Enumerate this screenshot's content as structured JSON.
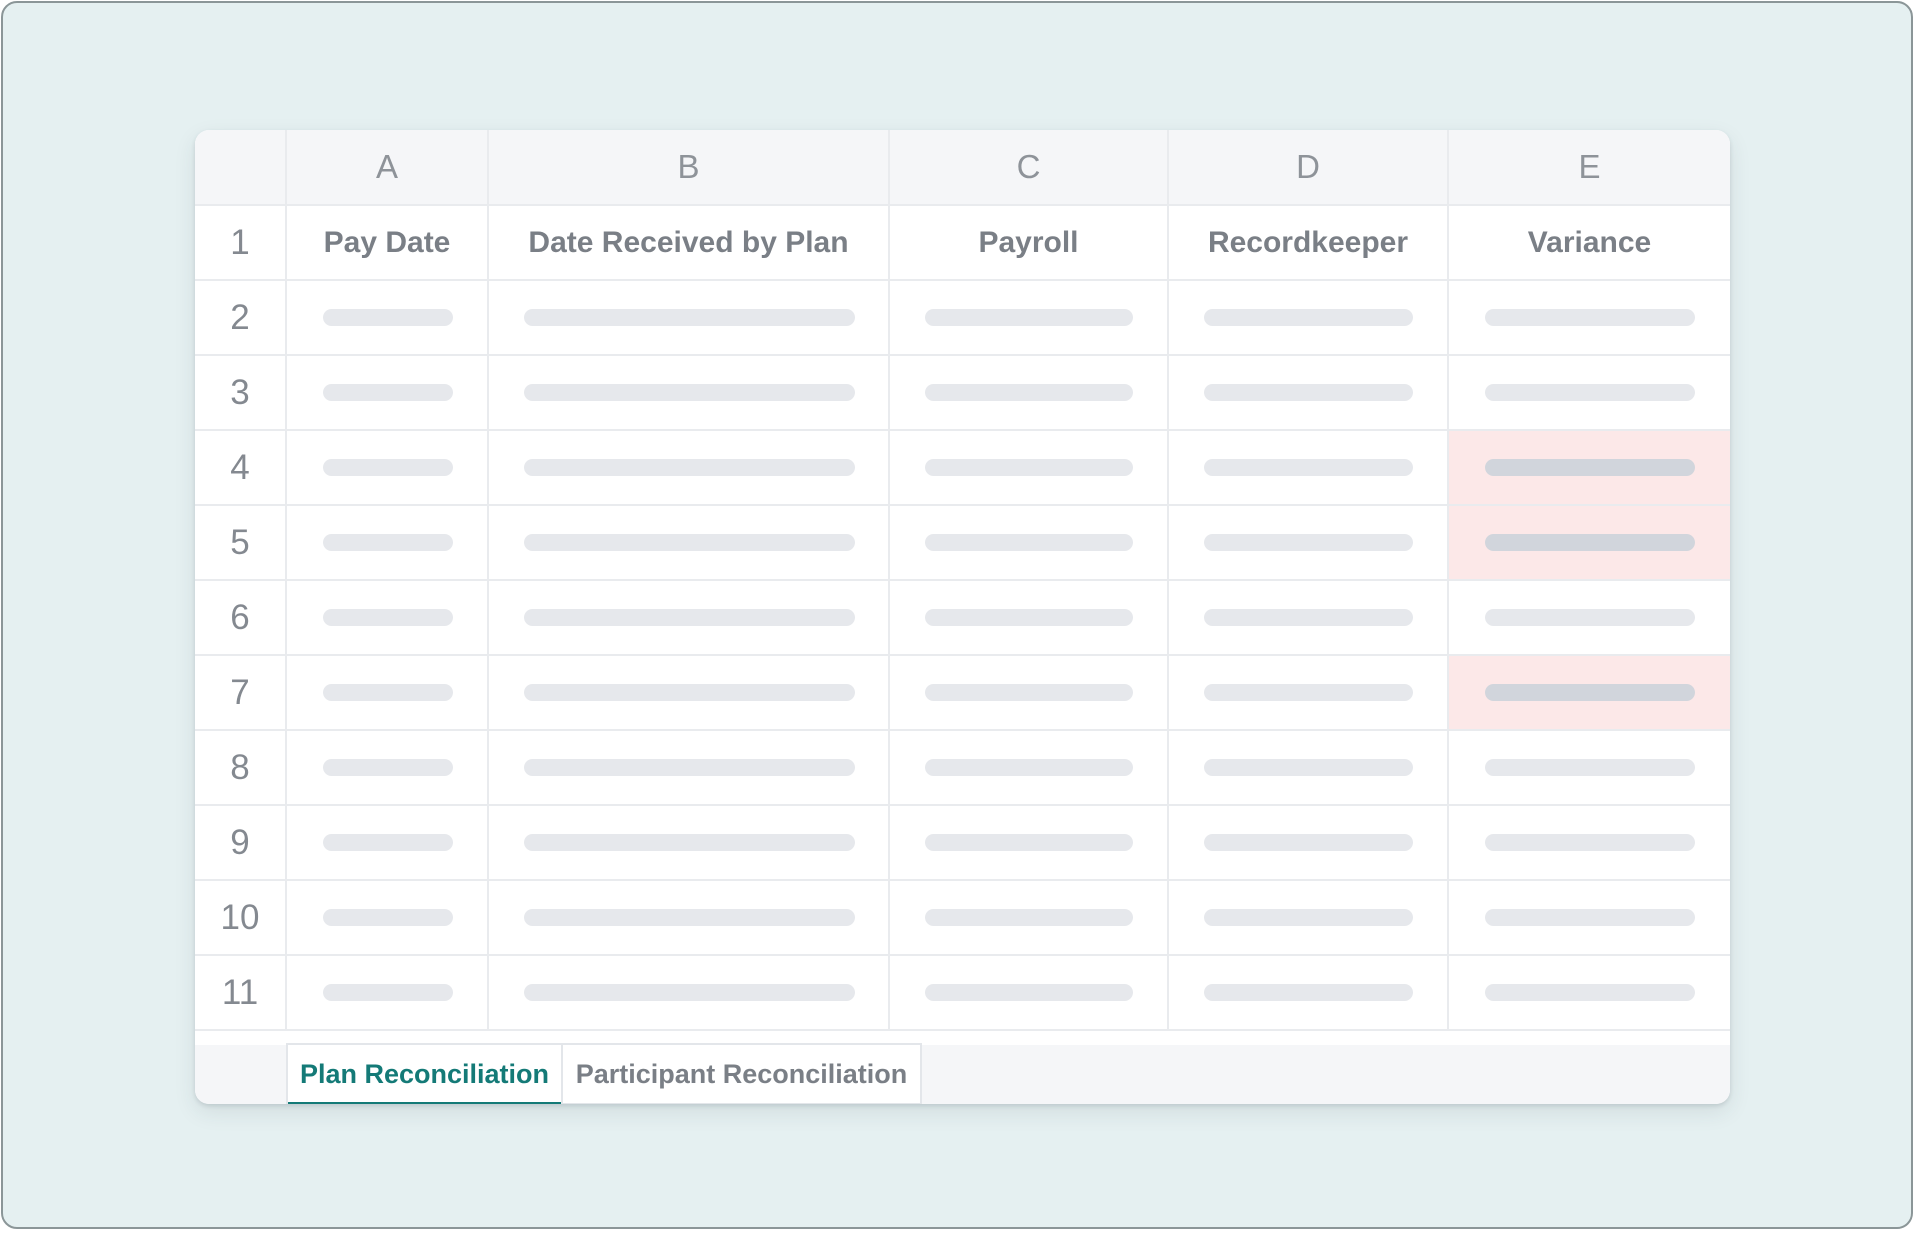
{
  "spreadsheet": {
    "columns": [
      "A",
      "B",
      "C",
      "D",
      "E"
    ],
    "header_row_number": "1",
    "headers": [
      "Pay Date",
      "Date Received by Plan",
      "Payroll",
      "Recordkeeper",
      "Variance"
    ],
    "rows": [
      {
        "number": "2",
        "variance_flagged": false
      },
      {
        "number": "3",
        "variance_flagged": false
      },
      {
        "number": "4",
        "variance_flagged": true
      },
      {
        "number": "5",
        "variance_flagged": true
      },
      {
        "number": "6",
        "variance_flagged": false
      },
      {
        "number": "7",
        "variance_flagged": true
      },
      {
        "number": "8",
        "variance_flagged": false
      },
      {
        "number": "9",
        "variance_flagged": false
      },
      {
        "number": "10",
        "variance_flagged": false
      },
      {
        "number": "11",
        "variance_flagged": false
      }
    ]
  },
  "tabs": [
    {
      "label": "Plan Reconciliation",
      "active": true
    },
    {
      "label": "Participant Reconciliation",
      "active": false
    }
  ],
  "colors": {
    "background": "#e5f0f1",
    "accent": "#147a77",
    "flag_background": "#fce8e8",
    "placeholder_bar": "#e6e8ec"
  }
}
